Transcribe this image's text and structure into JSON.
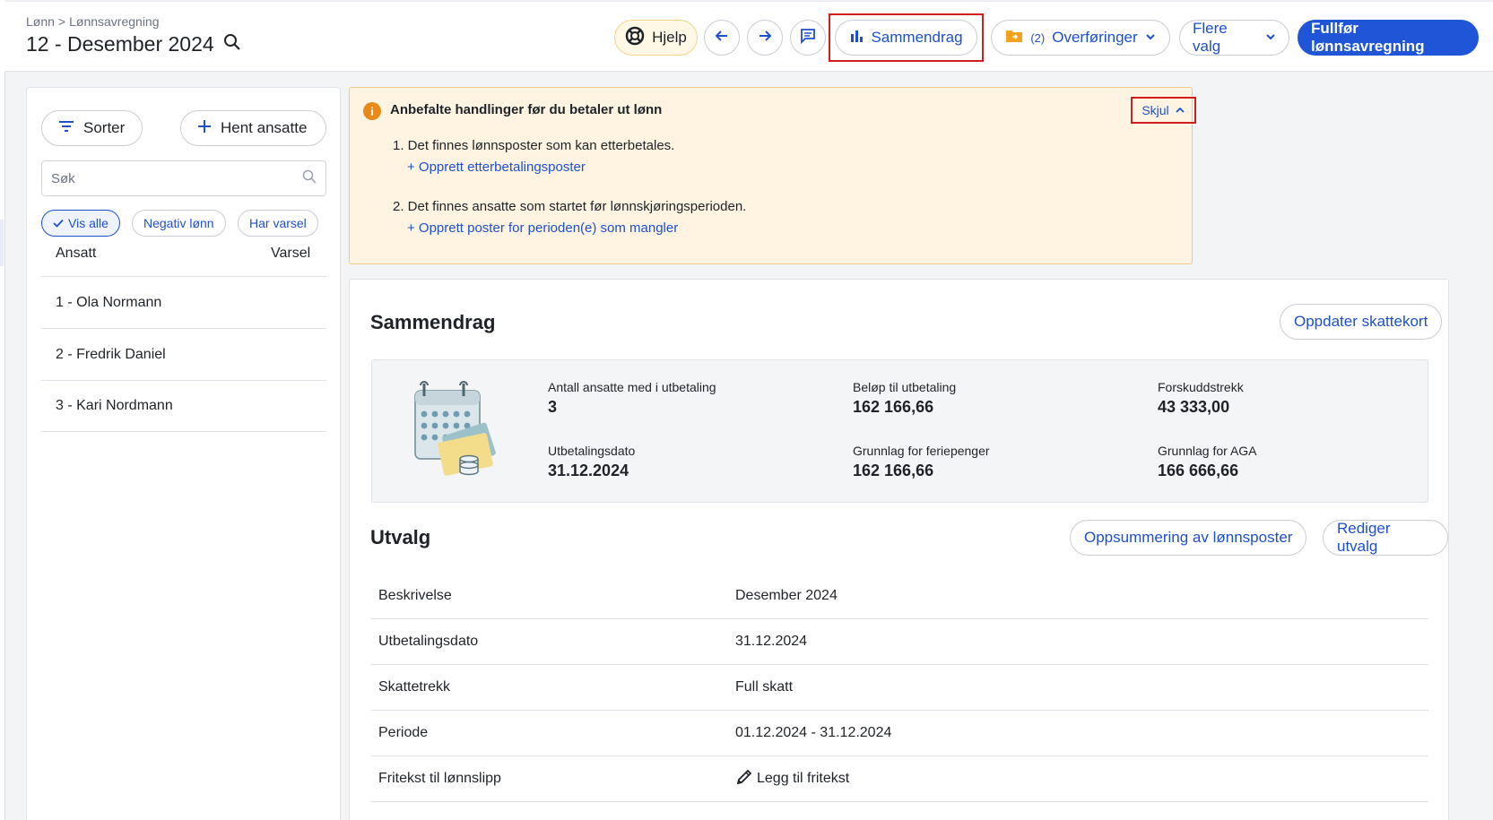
{
  "header": {
    "breadcrumb": [
      "Lønn",
      "Lønnsavregning"
    ],
    "breadcrumb_sep": ">",
    "title": "12 - Desember 2024",
    "help_label": "Hjelp",
    "summary_label": "Sammendrag",
    "transfers_count": "(2)",
    "transfers_label": "Overføringer",
    "more_label": "Flere valg",
    "finish_label": "Fullfør lønnsavregning"
  },
  "sidebar": {
    "sort_label": "Sorter",
    "fetch_label": "Hent ansatte",
    "search_placeholder": "Søk",
    "filters": [
      "Vis alle",
      "Negativ lønn",
      "Har varsel"
    ],
    "col_employee": "Ansatt",
    "col_warning": "Varsel",
    "employees": [
      "1 - Ola Normann",
      "2 - Fredrik Daniel",
      "3 - Kari Nordmann"
    ]
  },
  "alert": {
    "title": "Anbefalte handlinger før du betaler ut lønn",
    "hide_label": "Skjul",
    "item1": "1. Det finnes lønnsposter som kan etterbetales.",
    "link1": "+ Opprett etterbetalingsposter",
    "item2": "2. Det finnes ansatte som startet før lønnskjøringsperioden.",
    "link2": "+ Opprett poster for perioden(e) som mangler"
  },
  "summary": {
    "title": "Sammendrag",
    "update_tax_label": "Oppdater skattekort",
    "stats": [
      {
        "label": "Antall ansatte med i utbetaling",
        "value": "3"
      },
      {
        "label": "Beløp til utbetaling",
        "value": "162 166,66"
      },
      {
        "label": "Forskuddstrekk",
        "value": "43 333,00"
      },
      {
        "label": "Utbetalingsdato",
        "value": "31.12.2024"
      },
      {
        "label": "Grunnlag for feriepenger",
        "value": "162 166,66"
      },
      {
        "label": "Grunnlag for AGA",
        "value": "166 666,66"
      }
    ]
  },
  "selection": {
    "title": "Utvalg",
    "summary_btn": "Oppsummering av lønnsposter",
    "edit_btn": "Rediger utvalg",
    "rows": [
      {
        "key": "Beskrivelse",
        "value": "Desember 2024"
      },
      {
        "key": "Utbetalingsdato",
        "value": "31.12.2024"
      },
      {
        "key": "Skattetrekk",
        "value": "Full skatt"
      },
      {
        "key": "Periode",
        "value": "01.12.2024 - 31.12.2024"
      },
      {
        "key": "Fritekst til lønnslipp",
        "value": "Legg til fritekst"
      }
    ]
  },
  "colors": {
    "accent": "#1f55d6",
    "link": "#1d4fcf",
    "alert_bg": "#fff4e2",
    "alert_icon": "#e8891a",
    "highlight": "#d11f1f"
  },
  "icons": [
    "search-icon",
    "help-lifebuoy-icon",
    "arrow-left-icon",
    "arrow-right-icon",
    "comment-icon",
    "bar-chart-icon",
    "folder-transfer-icon",
    "chevron-down-icon",
    "filter-icon",
    "plus-icon",
    "check-icon",
    "info-icon",
    "chevron-up-icon",
    "calendar-money-illustration",
    "pencil-icon"
  ]
}
